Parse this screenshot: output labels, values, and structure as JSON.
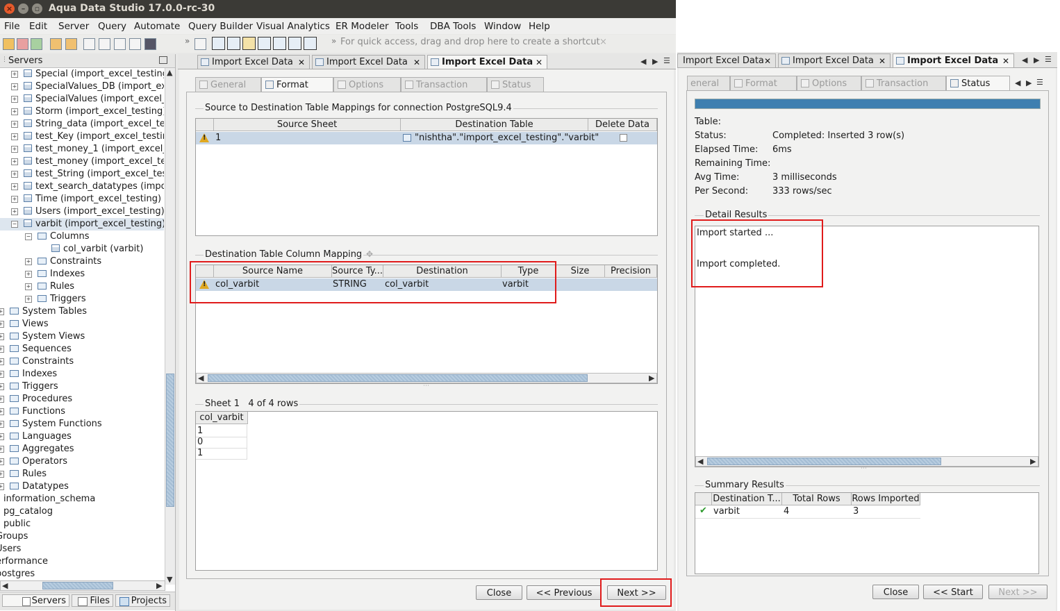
{
  "window": {
    "title": "Aqua Data Studio 17.0.0-rc-30"
  },
  "menu": [
    "File",
    "Edit",
    "Server",
    "Query",
    "Automate",
    "Query Builder",
    "Visual Analytics",
    "ER Modeler",
    "Tools",
    "DBA Tools",
    "Window",
    "Help"
  ],
  "toolbar": {
    "shortcut_hint": "For quick access, drag and drop here to create a shortcut"
  },
  "left_panel": {
    "header": "Servers",
    "tree": [
      "Special (import_excel_testing",
      "SpecialValues_DB (import_exc",
      "SpecialValues (import_excel_t",
      "Storm (import_excel_testing)",
      "String_data (import_excel_tes",
      "test_Key (import_excel_testin",
      "test_money_1 (import_excel_t",
      "test_money (import_excel_tes",
      "test_String (import_excel_test",
      "text_search_datatypes (impo",
      "Time (import_excel_testing)",
      "Users (import_excel_testing)",
      "varbit (import_excel_testing)",
      "Columns",
      "col_varbit (varbit)",
      "Constraints",
      "Indexes",
      "Rules",
      "Triggers",
      "System Tables",
      "Views",
      "System Views",
      "Sequences",
      "Constraints",
      "Indexes",
      "Triggers",
      "Procedures",
      "Functions",
      "System Functions",
      "Languages",
      "Aggregates",
      "Operators",
      "Rules",
      "Datatypes",
      "information_schema",
      "pg_catalog",
      "public",
      "Groups",
      "Users",
      "erformance",
      "postgres"
    ],
    "tabs": [
      "Servers",
      "Files",
      "Projects"
    ]
  },
  "center": {
    "tabs": [
      "Import Excel Data",
      "Import Excel Data",
      "Import Excel Data"
    ],
    "steps": [
      "General",
      "Format",
      "Options",
      "Transaction",
      "Status"
    ],
    "mapping_title": "Source to Destination Table Mappings for connection PostgreSQL9.4",
    "mapping_headers": [
      "Source Sheet",
      "Destination Table",
      "Delete Data"
    ],
    "mapping_row": {
      "sheet": "1",
      "table": "\"nishtha\".\"import_excel_testing\".\"varbit\""
    },
    "column_title": "Destination Table Column Mapping",
    "column_headers": [
      "Source Name",
      "Source Ty...",
      "Destination",
      "Type",
      "Size",
      "Precision"
    ],
    "column_row": {
      "source": "col_varbit",
      "stype": "STRING",
      "dest": "col_varbit",
      "type": "varbit"
    },
    "sheet_title": "Sheet 1",
    "sheet_rows_label": "4 of 4 rows",
    "sheet_header": "col_varbit",
    "sheet_values": [
      "1",
      "0",
      "1"
    ],
    "buttons": {
      "close": "Close",
      "previous": "<< Previous",
      "next": "Next >>"
    }
  },
  "right": {
    "tabs": [
      "Import Excel Data",
      "Import Excel Data",
      "Import Excel Data"
    ],
    "steps": [
      "eneral",
      "Format",
      "Options",
      "Transaction",
      "Status"
    ],
    "progress": 1.0,
    "status_labels": [
      "Table:",
      "Status:",
      "Elapsed Time:",
      "Remaining Time:",
      "Avg Time:",
      "Per Second:"
    ],
    "status_values": [
      "",
      "Completed: Inserted 3 row(s)",
      "6ms",
      "",
      "3 milliseconds",
      "333 rows/sec"
    ],
    "detail_title": "Detail Results",
    "detail_lines": [
      "Import started ...",
      "Import completed."
    ],
    "summary_title": "Summary Results",
    "summary_headers": [
      "Destination T...",
      "Total Rows",
      "Rows Imported"
    ],
    "summary_row": {
      "dest": "varbit",
      "total": "4",
      "imported": "3"
    },
    "buttons": {
      "close": "Close",
      "start": "<< Start",
      "next": "Next >>"
    }
  },
  "colors": {
    "highlight": "#e01b1b",
    "progress": "#3e7fb0",
    "selected_row": "#c9d7e6"
  }
}
